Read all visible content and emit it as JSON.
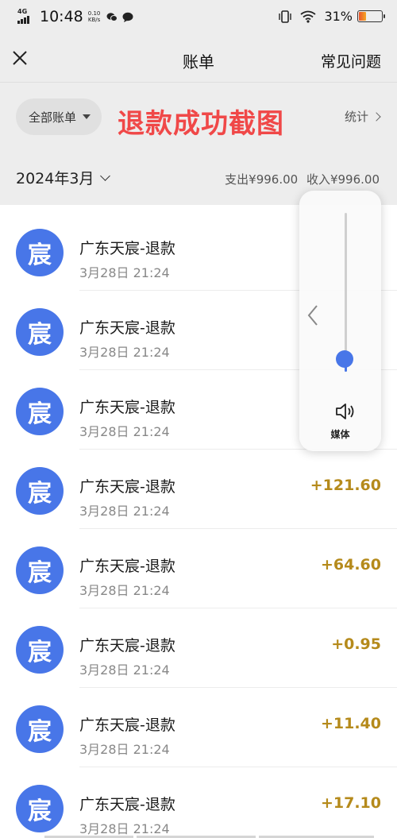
{
  "status_bar": {
    "network": "4G",
    "time": "10:48",
    "speed_value": "0.10",
    "speed_unit": "KB/s",
    "battery_percent": "31%",
    "battery_level": 0.31,
    "icons": [
      "signal-icon",
      "wechat-icon",
      "message-icon",
      "vibrate-icon",
      "wifi-icon",
      "battery-icon"
    ]
  },
  "nav": {
    "close_icon": "close-icon",
    "title": "账单",
    "faq_label": "常见问题"
  },
  "filter": {
    "all_bills_label": "全部账单",
    "annotation": "退款成功截图",
    "stats_label": "统计"
  },
  "month": {
    "label": "2024年3月",
    "expense": "支出¥996.00",
    "income": "收入¥996.00"
  },
  "transactions": [
    {
      "avatar": "宸",
      "name": "广东天宸-退款",
      "time": "3月28日 21:24",
      "amount": ""
    },
    {
      "avatar": "宸",
      "name": "广东天宸-退款",
      "time": "3月28日 21:24",
      "amount": ""
    },
    {
      "avatar": "宸",
      "name": "广东天宸-退款",
      "time": "3月28日 21:24",
      "amount": ""
    },
    {
      "avatar": "宸",
      "name": "广东天宸-退款",
      "time": "3月28日 21:24",
      "amount": "+121.60"
    },
    {
      "avatar": "宸",
      "name": "广东天宸-退款",
      "time": "3月28日 21:24",
      "amount": "+64.60"
    },
    {
      "avatar": "宸",
      "name": "广东天宸-退款",
      "time": "3月28日 21:24",
      "amount": "+0.95"
    },
    {
      "avatar": "宸",
      "name": "广东天宸-退款",
      "time": "3月28日 21:24",
      "amount": "+11.40"
    },
    {
      "avatar": "宸",
      "name": "广东天宸-退款",
      "time": "3月28日 21:24",
      "amount": "+17.10"
    }
  ],
  "volume": {
    "label": "媒体",
    "level": 0.08,
    "icons": [
      "chevron-left-icon",
      "speaker-icon"
    ]
  },
  "colors": {
    "background": "#ededed",
    "avatar_blue": "#4876e8",
    "amount_gold": "#b58a1b",
    "annotation_red": "#f04848"
  }
}
